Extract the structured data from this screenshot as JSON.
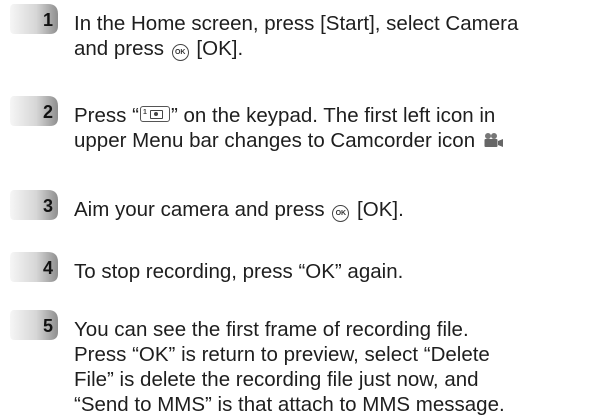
{
  "steps": [
    {
      "number": "1",
      "line1_a": "In the Home screen, press [Start], select Camera",
      "line2_a": "and press ",
      "ok_icon_label": "OK",
      "line2_b": " [OK]."
    },
    {
      "number": "2",
      "line1_a": "Press “",
      "keypad_icon_label": "1",
      "line1_b": "” on the keypad. The first left icon in",
      "line2_a": "upper Menu bar changes to Camcorder icon"
    },
    {
      "number": "3",
      "line1_a": "Aim your camera and press ",
      "ok_icon_label": "OK",
      "line1_b": " [OK]."
    },
    {
      "number": "4",
      "line1_a": "To stop recording, press “OK” again."
    },
    {
      "number": "5",
      "line1_a": "You can see the first frame of recording file.",
      "line2_a": "Press “OK” is return to preview, select “Delete",
      "line3_a": "File” is delete the recording file just now, and",
      "line4_a": "“Send to MMS” is that attach to MMS message."
    }
  ],
  "icons": {
    "step_badge": "rounded-tab-badge",
    "ok_button": "ok-button-icon",
    "keypad_key": "keypad-1-camera-key-icon",
    "camcorder": "camcorder-icon"
  },
  "colors": {
    "text": "#1e1e1e",
    "badge_light": "#f4f4f4",
    "badge_dark": "#9a9a9a"
  }
}
